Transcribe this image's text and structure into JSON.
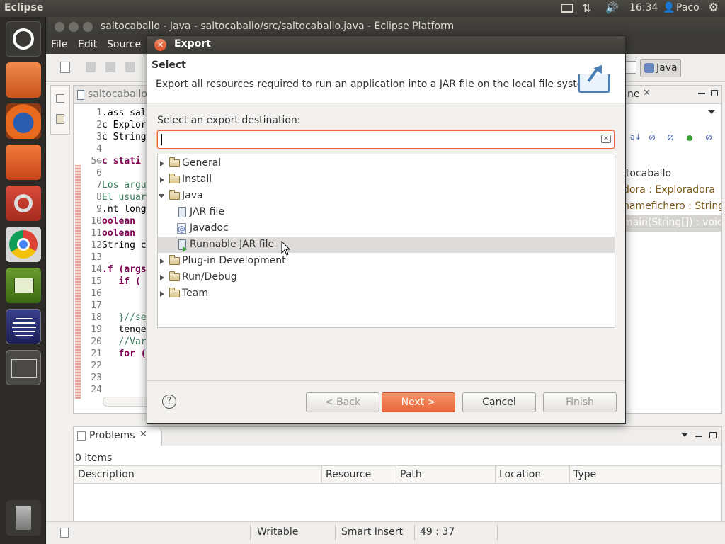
{
  "topbar": {
    "app_name": "Eclipse",
    "time": "16:34",
    "user": "Paco"
  },
  "window": {
    "title": "saltocaballo - Java - saltocaballo/src/saltocaballo.java - Eclipse Platform"
  },
  "menu": {
    "file": "File",
    "edit": "Edit",
    "source": "Source"
  },
  "perspective": {
    "label": "Java"
  },
  "editor": {
    "tab_label": "saltocaballo",
    "line_numbers": [
      "1",
      "2",
      "3",
      "4",
      "5⊖",
      "6",
      "7",
      "8",
      "9",
      "10",
      "11",
      "12",
      "13",
      "14",
      "15",
      "16",
      "17",
      "18",
      "19",
      "20",
      "21",
      "22",
      "23",
      "24"
    ],
    "lines": [
      ".ass sal",
      "c Explor",
      "c String",
      "",
      "c stati",
      "",
      "Los argu",
      "El usuar",
      ".nt long",
      "oolean ",
      "oolean ",
      "String c",
      "",
      ".f (args",
      "   if (",
      "",
      "",
      "   }//se",
      "   tenge",
      "   //Var",
      "   for (",
      "",
      "",
      ""
    ]
  },
  "outline": {
    "tab_label": "ne",
    "items": [
      "ltocaballo",
      "dora : Exploradora",
      "namefichero : String",
      "main(String[]) : void"
    ]
  },
  "problems": {
    "tab_label": "Problems",
    "count": "0 items",
    "columns": [
      "Description",
      "Resource",
      "Path",
      "Location",
      "Type"
    ]
  },
  "statusbar": {
    "writable": "Writable",
    "insert_mode": "Smart Insert",
    "position": "49 : 37"
  },
  "dialog": {
    "title": "Export",
    "heading": "Select",
    "description": "Export all resources required to run an application into a JAR file on the local file system.",
    "destination_label": "Select an export destination:",
    "filter_value": "",
    "tree": [
      {
        "label": "General",
        "type": "folder",
        "state": "collapsed"
      },
      {
        "label": "Install",
        "type": "folder",
        "state": "collapsed"
      },
      {
        "label": "Java",
        "type": "folder",
        "state": "expanded"
      },
      {
        "label": "JAR file",
        "type": "item"
      },
      {
        "label": "Javadoc",
        "type": "item"
      },
      {
        "label": "Runnable JAR file",
        "type": "item",
        "selected": true
      },
      {
        "label": "Plug-in Development",
        "type": "folder",
        "state": "collapsed"
      },
      {
        "label": "Run/Debug",
        "type": "folder",
        "state": "collapsed"
      },
      {
        "label": "Team",
        "type": "folder",
        "state": "collapsed"
      }
    ],
    "buttons": {
      "back": "< Back",
      "next": "Next >",
      "cancel": "Cancel",
      "finish": "Finish"
    },
    "help_glyph": "?"
  },
  "colors": {
    "accent": "#e8683c",
    "selection": "#dedcda"
  }
}
